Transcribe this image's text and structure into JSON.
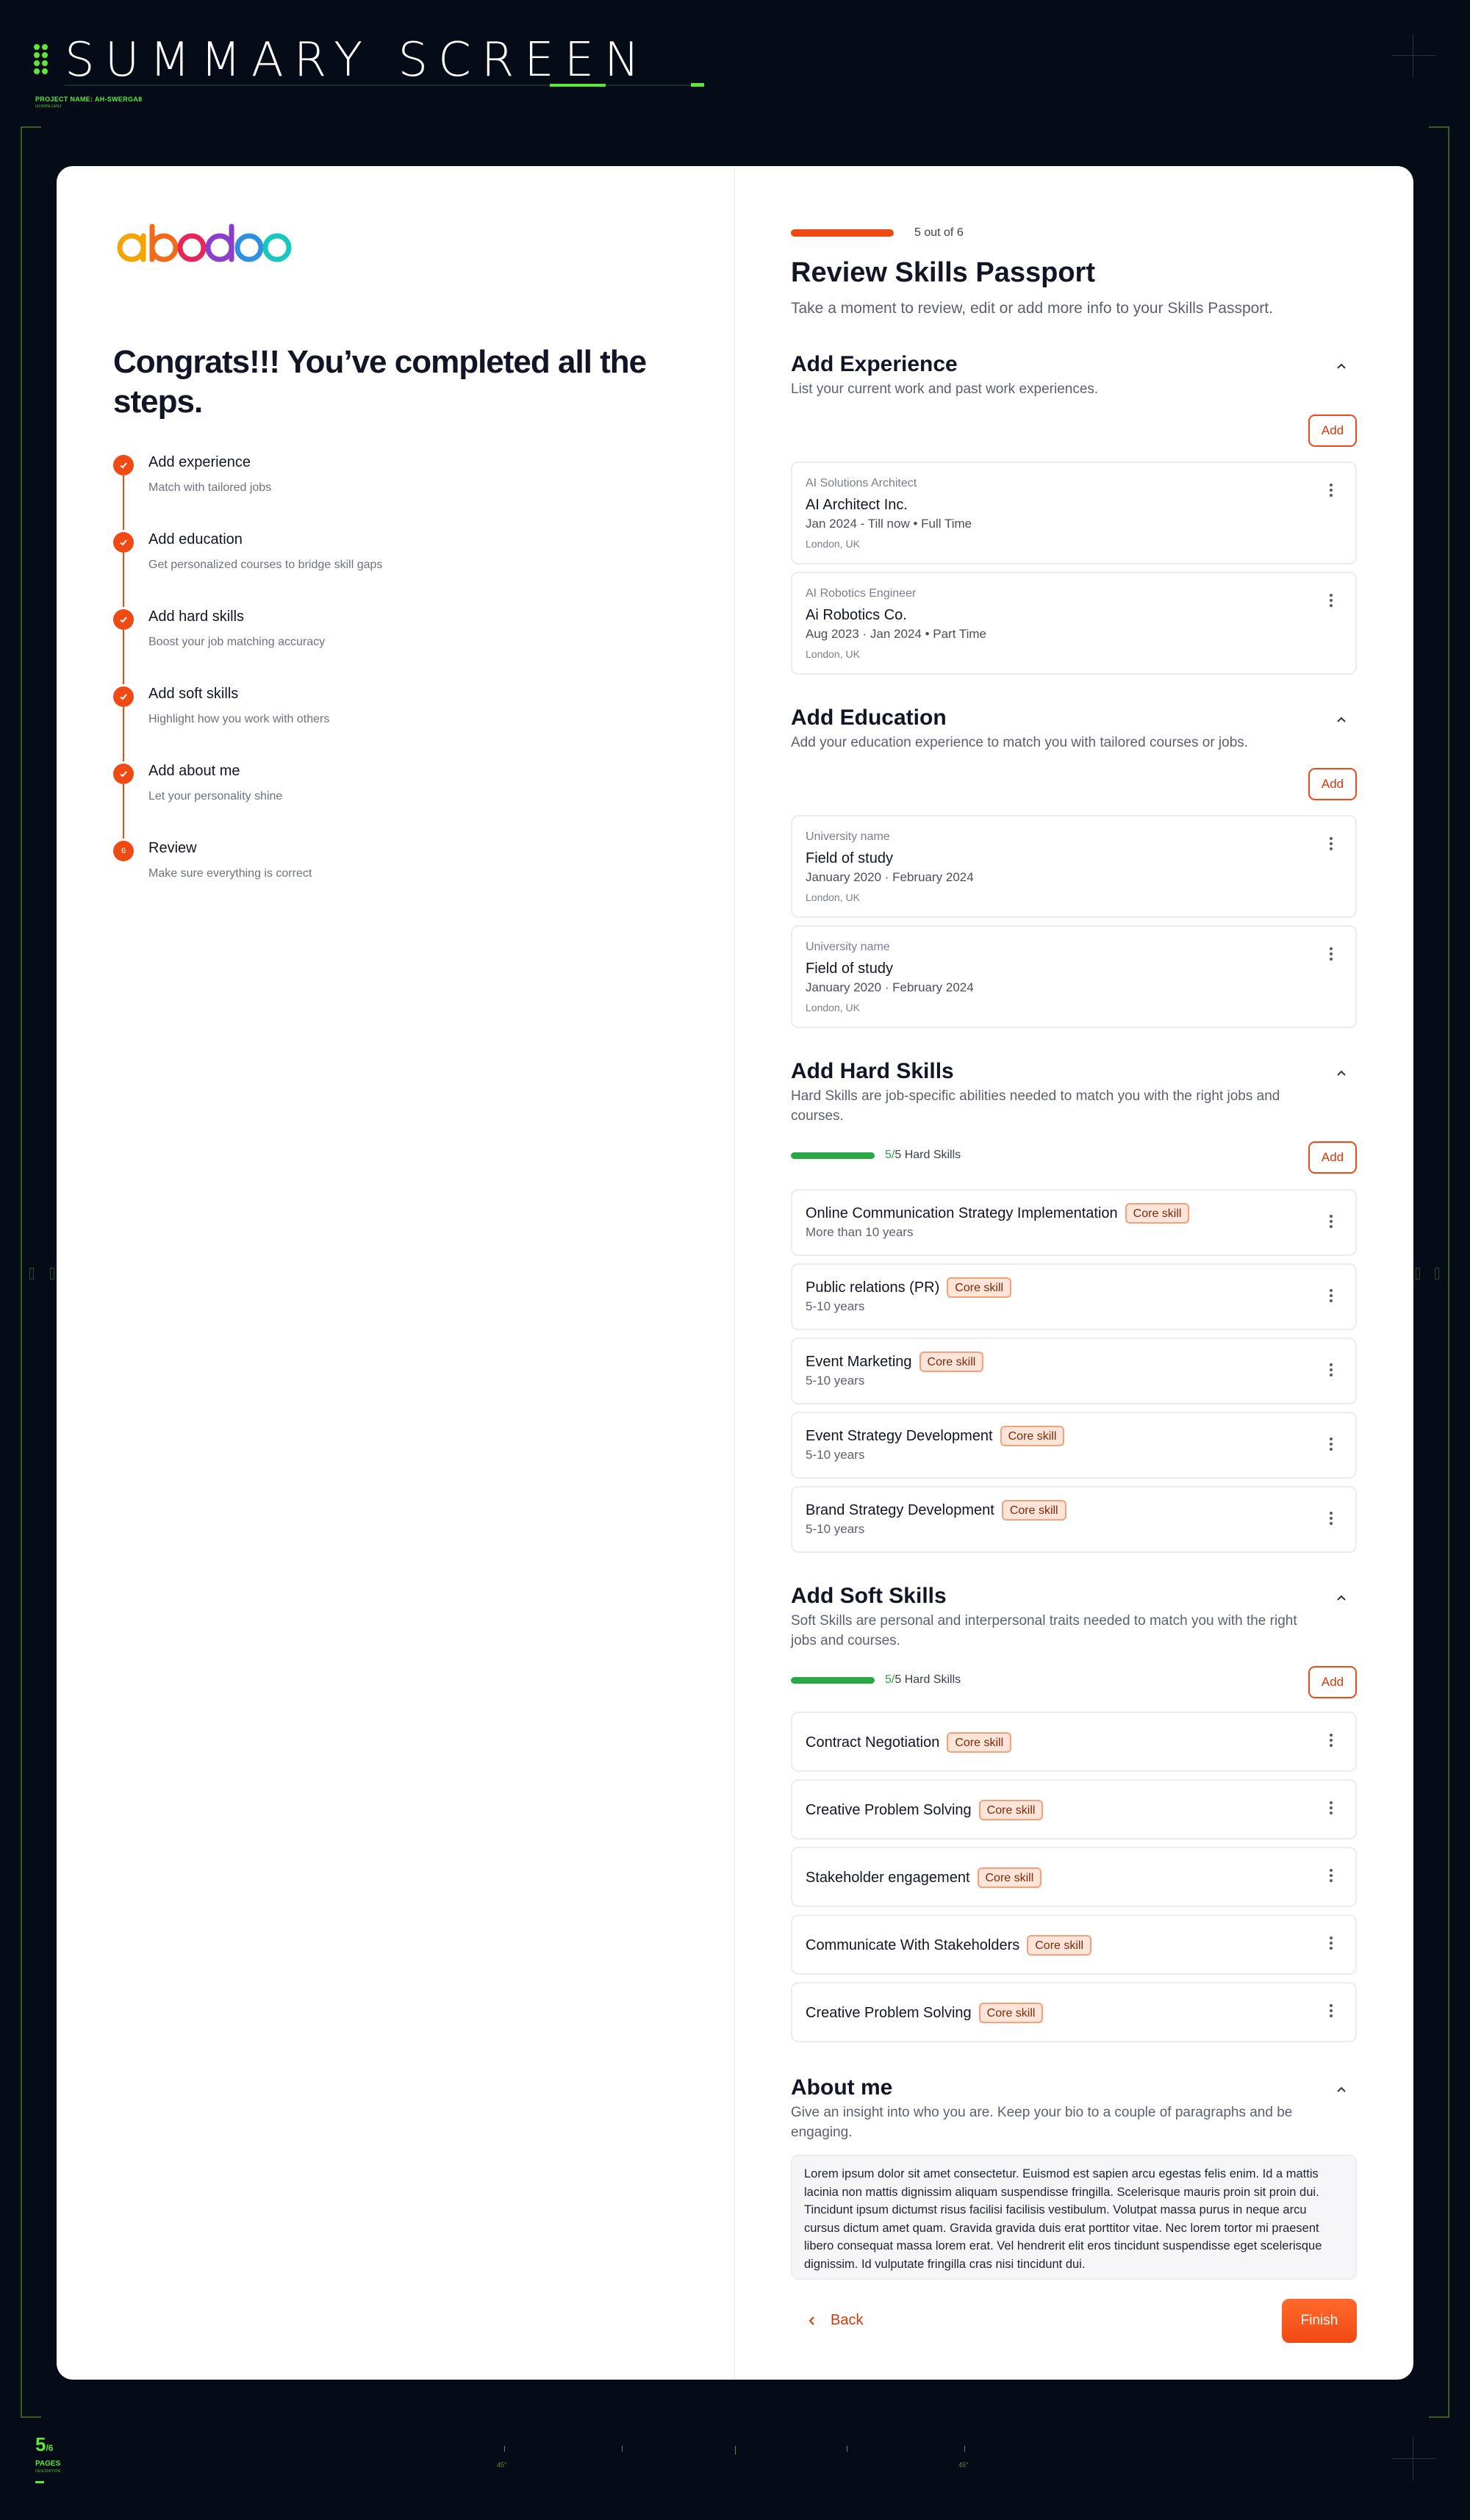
{
  "header": {
    "title": "SUMMARY SCREEN",
    "project_label": "PROJECT NAME: AH-SWERGA8",
    "project_sub": "DOWNLOAD"
  },
  "footer": {
    "page_current": "5",
    "page_total": "/6",
    "pages_label": "PAGES",
    "pages_sub": "DESCRIPTION",
    "angle_left": "45°",
    "angle_right": "45°"
  },
  "colors": {
    "accent": "#f04a14",
    "success": "#2aa845",
    "frame_green": "#5ee63a",
    "background": "#060b18"
  },
  "brand": {
    "logo_text": "abodoo",
    "logo_letters": [
      "a",
      "b",
      "o",
      "d",
      "o",
      "o"
    ],
    "logo_colors": [
      "#f5a300",
      "#f26a1b",
      "#e8255a",
      "#8a3ec9",
      "#2f8fe0",
      "#18c7c0"
    ]
  },
  "left": {
    "title": "Congrats!!! You’ve completed all the steps.",
    "steps": [
      {
        "title": "Add experience",
        "desc": "Match with tailored jobs",
        "state": "done"
      },
      {
        "title": "Add education",
        "desc": "Get personalized courses to bridge skill gaps",
        "state": "done"
      },
      {
        "title": "Add hard skills",
        "desc": "Boost your job matching accuracy",
        "state": "done"
      },
      {
        "title": "Add soft skills",
        "desc": "Highlight how you work with others",
        "state": "done"
      },
      {
        "title": "Add about me",
        "desc": "Let your personality shine",
        "state": "done"
      },
      {
        "title": "Review",
        "desc": "Make sure everything is correct",
        "state": "current",
        "number": "6"
      }
    ]
  },
  "right": {
    "progress_text": "5 out of 6",
    "progress_fraction": 0.83,
    "title": "Review Skills Passport",
    "subtitle": "Take a moment to review, edit or add more info to your Skills Passport.",
    "add_label": "Add",
    "experience": {
      "title": "Add Experience",
      "desc": "List your current work and past work experiences.",
      "items": [
        {
          "label": "AI Solutions Architect",
          "name": "AI Architect Inc.",
          "dates": "Jan 2024 - Till now  •  Full Time",
          "location": "London, UK"
        },
        {
          "label": "AI Robotics Engineer",
          "name": "Ai Robotics Co.",
          "dates": "Aug 2023 · Jan 2024  •  Part Time",
          "location": "London, UK"
        }
      ]
    },
    "education": {
      "title": "Add Education",
      "desc": "Add your education experience to match you with tailored courses or jobs.",
      "items": [
        {
          "label": "University name",
          "name": "Field of study",
          "dates": "January 2020 · February 2024",
          "location": "London, UK"
        },
        {
          "label": "University name",
          "name": "Field of study",
          "dates": "January 2020 · February 2024",
          "location": "London, UK"
        }
      ]
    },
    "hard_skills": {
      "title": "Add Hard Skills",
      "desc": "Hard Skills are job-specific abilities needed to match you with the right jobs and courses.",
      "count_current": "5/",
      "count_rest": "5 Hard Skills",
      "items": [
        {
          "name": "Online Communication Strategy Implementation",
          "badge": "Core skill",
          "years": "More than 10 years"
        },
        {
          "name": "Public relations (PR)",
          "badge": "Core skill",
          "years": "5-10 years"
        },
        {
          "name": "Event Marketing",
          "badge": "Core skill",
          "years": "5-10 years"
        },
        {
          "name": "Event Strategy Development",
          "badge": "Core skill",
          "years": "5-10 years"
        },
        {
          "name": "Brand Strategy Development",
          "badge": "Core skill",
          "years": "5-10 years"
        }
      ]
    },
    "soft_skills": {
      "title": "Add Soft Skills",
      "desc": "Soft Skills are personal and interpersonal traits needed to match you with the right jobs and courses.",
      "count_current": "5/",
      "count_rest": "5 Hard Skills",
      "items": [
        {
          "name": "Contract Negotiation",
          "badge": "Core skill"
        },
        {
          "name": "Creative Problem Solving",
          "badge": "Core skill"
        },
        {
          "name": "Stakeholder engagement",
          "badge": "Core skill"
        },
        {
          "name": "Communicate With Stakeholders",
          "badge": "Core skill"
        },
        {
          "name": "Creative Problem Solving",
          "badge": "Core skill"
        }
      ]
    },
    "about": {
      "title": "About me",
      "desc": "Give an insight into who you are. Keep your bio to a couple of paragraphs and be engaging.",
      "text": "Lorem ipsum dolor sit amet consectetur. Euismod est sapien arcu egestas felis enim. Id a mattis lacinia non mattis dignissim aliquam suspendisse fringilla. Scelerisque mauris proin sit proin dui. Tincidunt ipsum dictumst risus facilisi facilisis vestibulum. Volutpat massa purus in neque arcu cursus dictum amet quam. Gravida gravida duis erat porttitor vitae. Nec lorem tortor mi praesent libero consequat massa lorem erat. Vel hendrerit elit eros tincidunt suspendisse eget scelerisque dignissim. Id vulputate fringilla cras nisi tincidunt dui."
    },
    "back_label": "Back",
    "finish_label": "Finish"
  }
}
